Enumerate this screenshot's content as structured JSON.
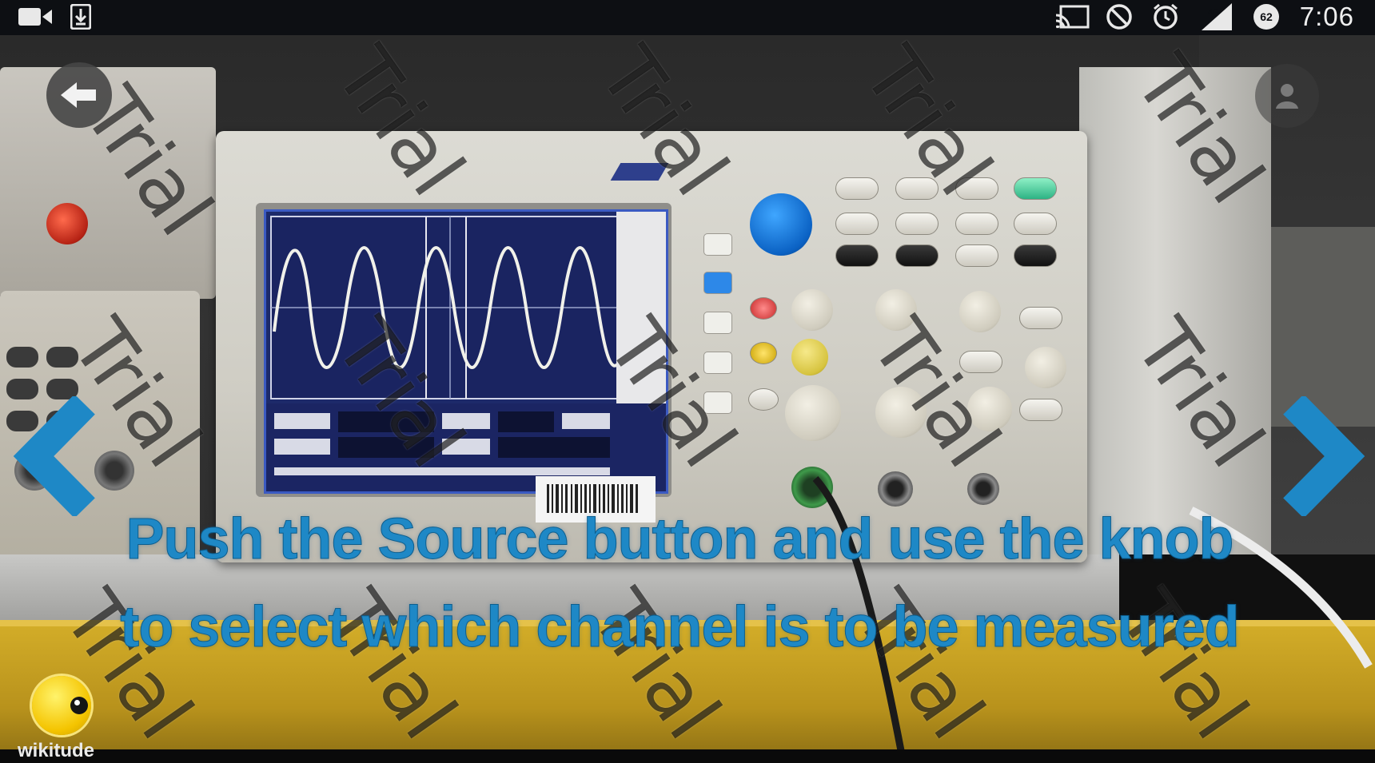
{
  "status_bar": {
    "time": "7:06",
    "battery_level": "62",
    "icons": [
      "video-camera-icon",
      "download-icon",
      "cast-icon",
      "do-not-disturb-icon",
      "alarm-icon",
      "cellular-signal-icon",
      "battery-icon"
    ]
  },
  "ar_overlay": {
    "instruction": "Push the Source button and use the knob to select which channel is to be measured",
    "watermark_text": "Trial",
    "accent_color": "#1e88c6",
    "navigation": {
      "previous_icon": "chevron-left-icon",
      "next_icon": "chevron-right-icon"
    }
  },
  "branding": {
    "sdk_logo_text": "wikitude"
  },
  "controls": {
    "back_icon": "back-arrow-icon",
    "user_icon": "user-icon"
  }
}
